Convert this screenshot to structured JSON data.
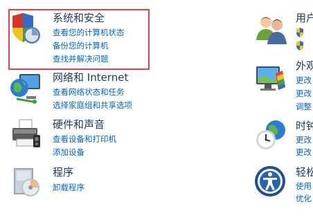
{
  "left_column": [
    {
      "title": "系统和安全",
      "icon": "security-shield-icon",
      "links": [
        "查看您的计算机状态",
        "备份您的计算机",
        "查找并解决问题"
      ]
    },
    {
      "title": "网络和 Internet",
      "icon": "network-globe-icon",
      "links": [
        "查看网络状态和任务",
        "选择家庭组和共享选项"
      ]
    },
    {
      "title": "硬件和声音",
      "icon": "printer-icon",
      "links": [
        "查看设备和打印机",
        "添加设备"
      ]
    },
    {
      "title": "程序",
      "icon": "programs-disc-icon",
      "links": [
        "卸载程序"
      ]
    }
  ],
  "right_column": [
    {
      "title": "用户",
      "icon": "users-icon",
      "links": [
        "",
        ""
      ],
      "link_shields": [
        true,
        true
      ]
    },
    {
      "title": "外观",
      "icon": "display-appearance-icon",
      "links": [
        "更改",
        "更改",
        "调整"
      ]
    },
    {
      "title": "时钟",
      "icon": "clock-globe-icon",
      "links": [
        "更改",
        "更改"
      ]
    },
    {
      "title": "轻松",
      "icon": "ease-of-access-icon",
      "links": [
        "使用",
        "优化"
      ]
    }
  ],
  "colors": {
    "title": "#1e395b",
    "link": "#0066cc",
    "highlight_border": "#e8414a"
  }
}
